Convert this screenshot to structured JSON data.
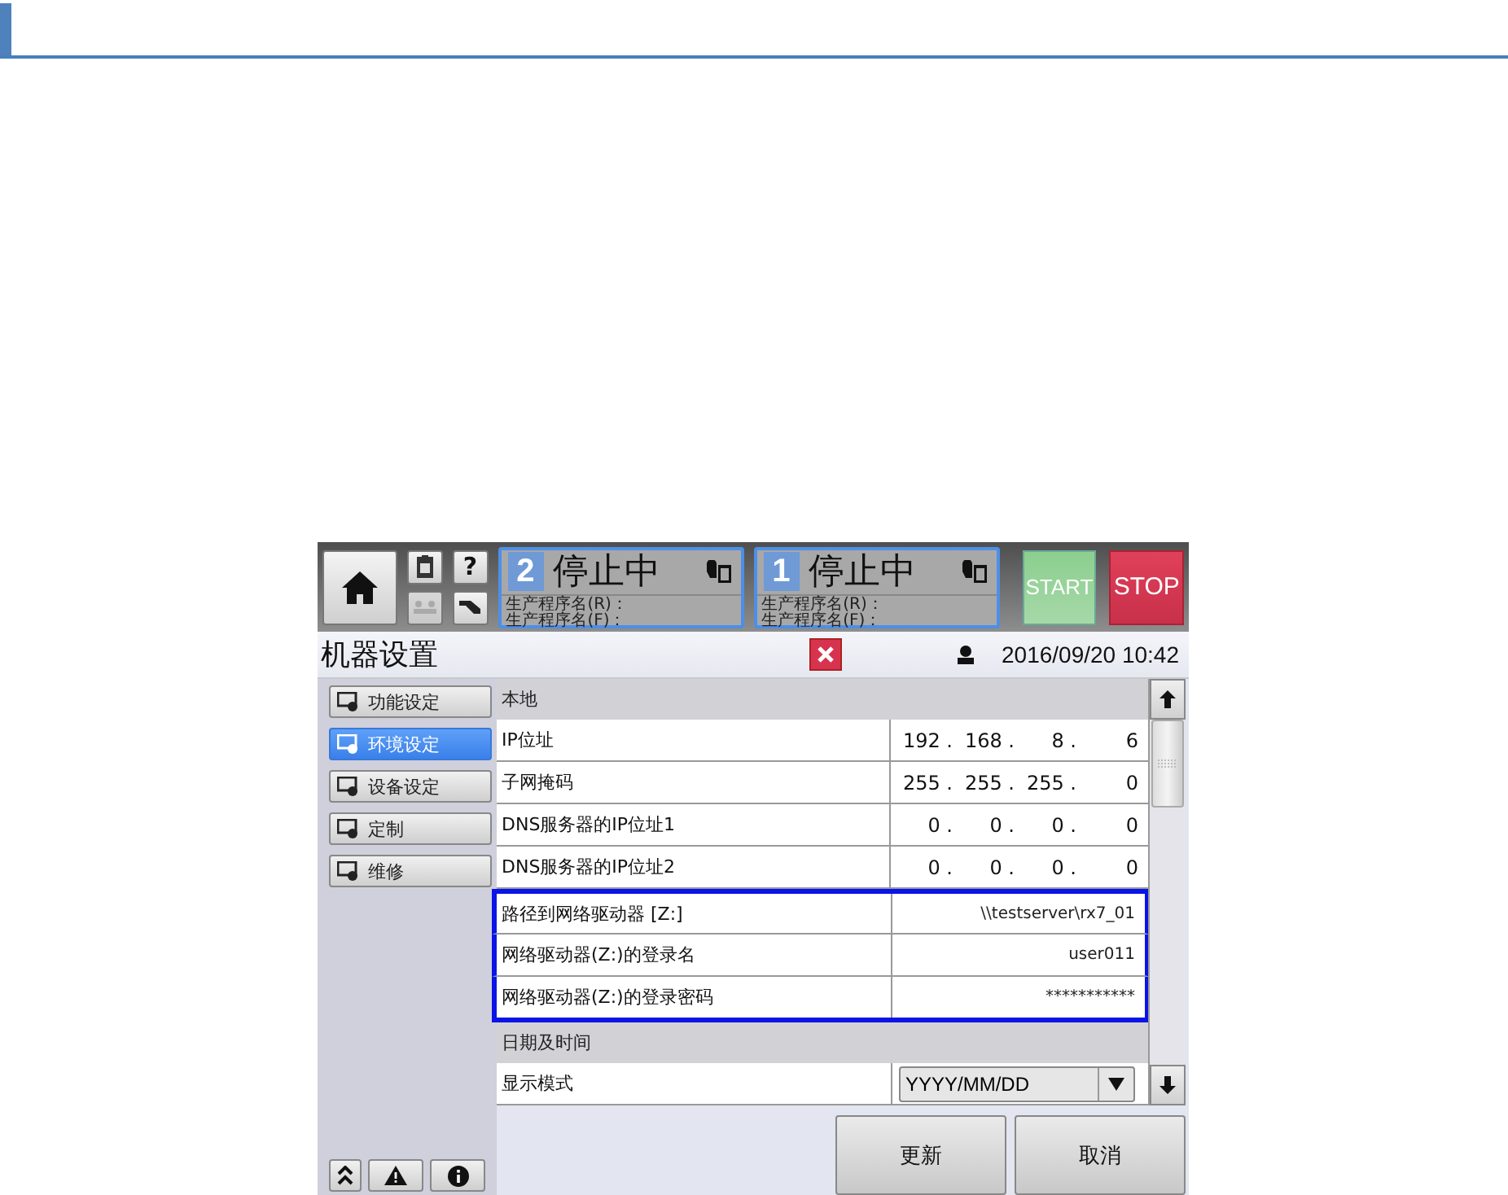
{
  "hmi": {
    "help_button": "?",
    "stations": [
      {
        "number": "2",
        "status": "停止中",
        "program_lines": [
          "生产程序名(R)：",
          "生产程序名(F)："
        ]
      },
      {
        "number": "1",
        "status": "停止中",
        "program_lines": [
          "生产程序名(R)：",
          "生产程序名(F)："
        ]
      }
    ],
    "start_button": "START",
    "stop_button": "STOP",
    "title": "机器设置",
    "datetime": "2016/09/20 10:42",
    "sidebar": [
      {
        "label": "功能设定",
        "selected": false
      },
      {
        "label": "环境设定",
        "selected": true
      },
      {
        "label": "设备设定",
        "selected": false
      },
      {
        "label": "定制",
        "selected": false
      },
      {
        "label": "维修",
        "selected": false
      }
    ],
    "sections": [
      {
        "title": "本地",
        "rows": [
          {
            "kind": "ip",
            "label": "IP位址",
            "octets": [
              "192 .",
              "168 .",
              "8 .",
              "6"
            ],
            "highlighted": false
          },
          {
            "kind": "ip",
            "label": "子网掩码",
            "octets": [
              "255 .",
              "255 .",
              "255 .",
              "0"
            ],
            "highlighted": false
          },
          {
            "kind": "ip",
            "label": "DNS服务器的IP位址1",
            "octets": [
              "0 .",
              "0 .",
              "0 .",
              "0"
            ],
            "highlighted": false
          },
          {
            "kind": "ip",
            "label": "DNS服务器的IP位址2",
            "octets": [
              "0 .",
              "0 .",
              "0 .",
              "0"
            ],
            "highlighted": false
          },
          {
            "kind": "text",
            "label": "路径到网络驱动器 [Z:]",
            "value": "\\\\testserver\\rx7_01",
            "highlighted": true
          },
          {
            "kind": "text",
            "label": "网络驱动器(Z:)的登录名",
            "value": "user011",
            "highlighted": true
          },
          {
            "kind": "text",
            "label": "网络驱动器(Z:)的登录密码",
            "value": "***********",
            "highlighted": true
          }
        ]
      },
      {
        "title": "日期及时间",
        "rows": [
          {
            "kind": "select",
            "label": "显示模式",
            "value": "YYYY/MM/DD",
            "highlighted": false
          }
        ]
      }
    ],
    "actions": [
      "更新",
      "取消"
    ]
  }
}
